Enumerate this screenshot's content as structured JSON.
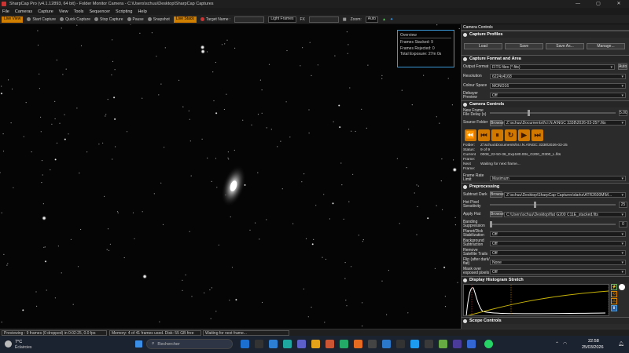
{
  "window": {
    "title": "SharpCap Pro (v4.1.12893, 64 bit) - Folder Monitor Camera - C:\\Users\\schuu\\Desktop\\SharpCap Captures",
    "minimize": "—",
    "maximize": "▢",
    "close": "✕"
  },
  "menu": [
    "File",
    "Cameras",
    "Capture",
    "View",
    "Tools",
    "Sequencer",
    "Scripting",
    "Help"
  ],
  "toolbar": {
    "live_view": "Live View",
    "start_capture": "Start Capture",
    "quick_capture": "Quick Capture",
    "stop_capture": "Stop Capture",
    "pause": "Pause",
    "snapshot": "Snapshot",
    "live_stack": "Live Stack",
    "target_name": "Target Name :",
    "light_frames": "Light Frames",
    "fx": "FX",
    "zoom_label": "Zoom:",
    "zoom_value": "Auto"
  },
  "overview": {
    "title": "Overview",
    "frames_stacked": "Frames Stacked:  9",
    "frames_rejected": "Frames Rejected:  0",
    "total_exposure": "Total Exposure:    27m 0s"
  },
  "panel": {
    "header": "Camera Controls",
    "capture_profiles": {
      "title": "Capture Profiles",
      "load": "Load",
      "save": "Save",
      "save_as": "Save As...",
      "manage": "Manage..."
    },
    "capture_format": {
      "title": "Capture Format and Area",
      "output_format_label": "Output Format",
      "output_format": "FITS files (*.fits)",
      "auto": "Auto",
      "resolution_label": "Resolution",
      "resolution": "6224x4168",
      "colour_space_label": "Colour Space",
      "colour_space": "MONO16",
      "debayer_label": "Debayer Preview",
      "debayer": "Off"
    },
    "camera_controls": {
      "title": "Camera Controls",
      "new_frame_label": "New Frame File Delay (s)",
      "new_frame_value": "5.00",
      "source_folder_label": "Source Folder",
      "browse": "Browse",
      "source_folder": "Z:\\schuu\\Documents\\N.I.N.A\\NGC 3338\\2026-03-25\\*.fits",
      "folder_label": "Folder:",
      "folder": "Z:\\schuu\\Documents\\N.I.N.A\\NGC 3338\\2026-03-25",
      "status_label": "Status:",
      "status": "9 of 9",
      "current_frame_label": "Current Frame:",
      "current_frame": "0008_22-50-36_Exp180.00s_G200_O300_L.fits",
      "next_frame_label": "Next Frame:",
      "next_frame": "Waiting for next frame...",
      "frame_rate_label": "Frame Rate Limit",
      "frame_rate": "Maximum"
    },
    "preprocessing": {
      "title": "Preprocessing",
      "subtract_dark_label": "Subtract Dark",
      "subtract_dark": "Z:\\schuu\\Desktop\\SharpCap Captures\\darks\\ATR2600M\\M...",
      "hot_pixel_label": "Hot Pixel Sensitivity",
      "hot_pixel_value": "25",
      "apply_flat_label": "Apply Flat",
      "apply_flat": "C:\\Users\\schuu\\Desktop\\flat G200 C11E_stacked.fits",
      "banding_label": "Banding Suppression",
      "banding_value": "0",
      "planet_label": "Planet/Disk Stabilization",
      "planet": "Off",
      "background_label": "Background Subtraction",
      "background": "Off",
      "satellite_label": "Remove Satellite Trails",
      "satellite": "Off",
      "filp_label": "Flip (after dark/ flat)",
      "flip": "None",
      "mask_label": "Mask over exposed pixels",
      "mask": "Off"
    },
    "histogram": {
      "title": "Display Histogram Stretch"
    },
    "scope": {
      "title": "Scope Controls"
    }
  },
  "statusbar": {
    "preview": "Previewing : 9 frames (0 dropped) in 0:02:25, 0.0 fps",
    "memory": "Memory: 4 of 41 frames used. Disk: 55 GB free",
    "waiting": "Waiting for next frame..."
  },
  "taskbar": {
    "weather_temp": "7°C",
    "weather_desc": "Éclaircies",
    "search_placeholder": "Rechercher",
    "time": "22:58",
    "date": "25/03/2026"
  }
}
